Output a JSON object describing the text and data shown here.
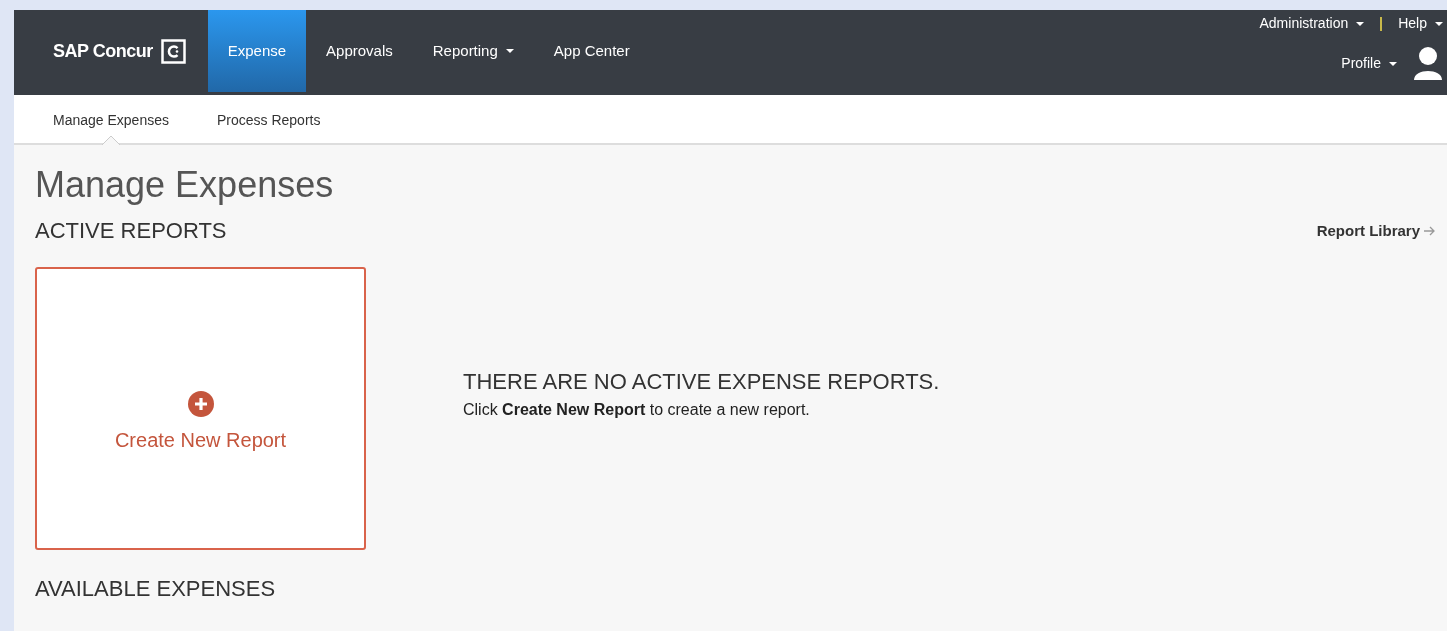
{
  "navbar": {
    "brand": "SAP Concur",
    "items": [
      {
        "label": "Expense",
        "selected": true,
        "has_menu": false
      },
      {
        "label": "Approvals",
        "selected": false,
        "has_menu": false
      },
      {
        "label": "Reporting",
        "selected": false,
        "has_menu": true
      },
      {
        "label": "App Center",
        "selected": false,
        "has_menu": false
      }
    ],
    "utility_links": [
      {
        "label": "Administration",
        "has_menu": true
      },
      {
        "label": "Help",
        "has_menu": true
      }
    ],
    "profile": {
      "label": "Profile",
      "has_menu": true
    }
  },
  "subnav": [
    {
      "label": "Manage Expenses",
      "selected": true
    },
    {
      "label": "Process Reports",
      "selected": false
    }
  ],
  "page_title": "Manage Expenses",
  "active_reports": {
    "heading": "ACTIVE REPORTS",
    "library_link": "Report Library",
    "create_card": {
      "label": "Create New Report"
    },
    "empty_title": "THERE ARE NO ACTIVE EXPENSE REPORTS.",
    "empty_text": "Click **Create New Report** to create a new report."
  },
  "available_expenses": {
    "heading": "AVAILABLE EXPENSES"
  }
}
